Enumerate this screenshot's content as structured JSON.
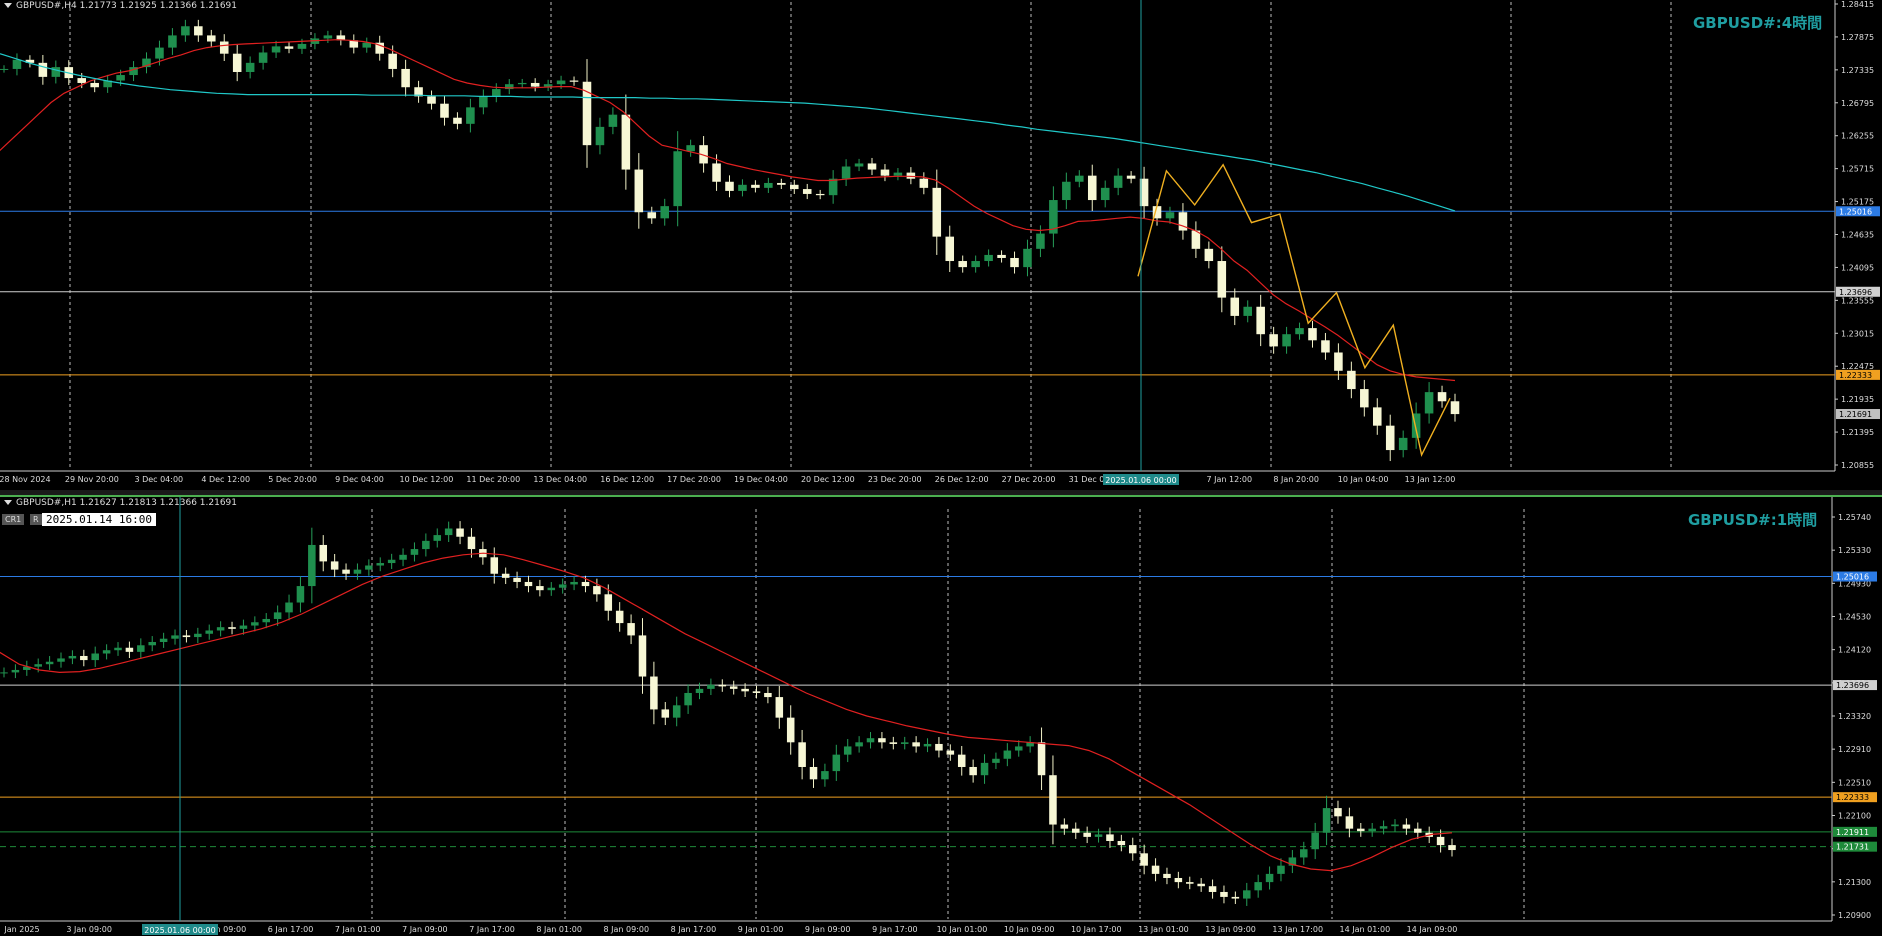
{
  "top_chart": {
    "info": "GBPUSD#,H4  1.21773 1.21925 1.21366 1.21691",
    "watermark": "GBPUSD#:4時間",
    "price_min": 1.20855,
    "price_max": 1.28415,
    "price_labels": [
      "1.28415",
      "1.27875",
      "1.27335",
      "1.26795",
      "1.26255",
      "1.25715",
      "1.25175",
      "1.24635",
      "1.24095",
      "1.23555",
      "1.23015",
      "1.22475",
      "1.21935",
      "1.21395",
      "1.20855"
    ],
    "hlines": [
      {
        "price": 1.25016,
        "label": "1.25016",
        "color": "#2c7be5",
        "text_color": "#ffffff"
      },
      {
        "price": 1.23696,
        "label": "1.23696",
        "color": "#d0d0d0",
        "text_color": "#000000"
      },
      {
        "price": 1.22333,
        "label": "1.22333",
        "color": "#f0a020",
        "text_color": "#000000"
      },
      {
        "price": 1.21691,
        "label": "1.21691",
        "color": "#c0c0c0",
        "text_color": "#000000",
        "tag_only": true
      }
    ],
    "time_labels": [
      "28 Nov 2024",
      "29 Nov 20:00",
      "3 Dec 04:00",
      "4 Dec 12:00",
      "5 Dec 20:00",
      "9 Dec 04:00",
      "10 Dec 12:00",
      "11 Dec 20:00",
      "13 Dec 04:00",
      "16 Dec 12:00",
      "17 Dec 20:00",
      "19 Dec 04:00",
      "20 Dec 12:00",
      "23 Dec 20:00",
      "26 Dec 12:00",
      "27 Dec 20:00",
      "31 Dec 04:00",
      "2 Ja",
      "7 Jan 12:00",
      "8 Jan 20:00",
      "10 Jan 04:00",
      "13 Jan 12:00"
    ],
    "crosshair_time": "2025.01.06 00:00",
    "crosshair_time_tail": "00",
    "zigzag": [
      1.2395,
      1.2568,
      1.2512,
      1.2578,
      1.2483,
      1.2497,
      1.2318,
      1.2368,
      1.2245,
      1.2315,
      1.2102,
      1.2195
    ],
    "close_series": [
      1.2735,
      1.275,
      1.2745,
      1.2722,
      1.2738,
      1.272,
      1.2712,
      1.2705,
      1.2716,
      1.2725,
      1.2738,
      1.2752,
      1.277,
      1.279,
      1.2805,
      1.279,
      1.278,
      1.276,
      1.273,
      1.2745,
      1.2762,
      1.2772,
      1.2768,
      1.2776,
      1.2785,
      1.279,
      1.2782,
      1.277,
      1.2778,
      1.276,
      1.2735,
      1.2705,
      1.269,
      1.2678,
      1.2655,
      1.2645,
      1.2672,
      1.269,
      1.2702,
      1.271,
      1.2712,
      1.2706,
      1.271,
      1.2716,
      1.2714,
      1.261,
      1.264,
      1.266,
      1.257,
      1.25,
      1.249,
      1.251,
      1.26,
      1.261,
      1.258,
      1.255,
      1.2535,
      1.2545,
      1.254,
      1.2548,
      1.2545,
      1.2538,
      1.253,
      1.2528,
      1.2555,
      1.2575,
      1.258,
      1.257,
      1.256,
      1.2565,
      1.2555,
      1.254,
      1.246,
      1.242,
      1.241,
      1.242,
      1.243,
      1.2425,
      1.241,
      1.244,
      1.2465,
      1.252,
      1.255,
      1.256,
      1.252,
      1.254,
      1.256,
      1.2555,
      1.251,
      1.249,
      1.25,
      1.247,
      1.244,
      1.242,
      1.236,
      1.233,
      1.2345,
      1.23,
      1.228,
      1.23,
      1.231,
      1.229,
      1.227,
      1.224,
      1.221,
      1.218,
      1.215,
      1.211,
      1.213,
      1.217,
      1.2205,
      1.219,
      1.2169
    ],
    "ema_fast": [
      1.26,
      1.262,
      1.264,
      1.266,
      1.268,
      1.2695,
      1.2705,
      1.2715,
      1.2722,
      1.2728,
      1.2732,
      1.2738,
      1.2745,
      1.2752,
      1.2758,
      1.2765,
      1.277,
      1.2773,
      1.2775,
      1.2776,
      1.2777,
      1.2778,
      1.2779,
      1.278,
      1.2781,
      1.2782,
      1.2783,
      1.2782,
      1.278,
      1.2776,
      1.2768,
      1.2758,
      1.2748,
      1.2738,
      1.2728,
      1.2718,
      1.2712,
      1.2708,
      1.2705,
      1.2704,
      1.2704,
      1.2704,
      1.2705,
      1.2706,
      1.2706,
      1.27,
      1.269,
      1.268,
      1.2665,
      1.2645,
      1.2625,
      1.261,
      1.2605,
      1.26,
      1.2595,
      1.2588,
      1.258,
      1.2575,
      1.257,
      1.2566,
      1.2562,
      1.2558,
      1.2555,
      1.2552,
      1.2552,
      1.2554,
      1.2556,
      1.2557,
      1.2558,
      1.2559,
      1.2559,
      1.2558,
      1.2553,
      1.254,
      1.2525,
      1.251,
      1.2498,
      1.2488,
      1.2478,
      1.2472,
      1.247,
      1.2472,
      1.2478,
      1.2485,
      1.2486,
      1.2488,
      1.249,
      1.2492,
      1.249,
      1.2486,
      1.2484,
      1.2478,
      1.247,
      1.2458,
      1.244,
      1.242,
      1.2405,
      1.2385,
      1.2365,
      1.235,
      1.2338,
      1.2325,
      1.2312,
      1.2298,
      1.2282,
      1.2266,
      1.225,
      1.224,
      1.2234,
      1.223,
      1.2228,
      1.2226,
      1.2224
    ],
    "sma_slow": [
      1.276,
      1.2752,
      1.2744,
      1.2737,
      1.2731,
      1.2725,
      1.272,
      1.2715,
      1.2711,
      1.2707,
      1.2704,
      1.2701,
      1.2699,
      1.2697,
      1.2695,
      1.2694,
      1.2693,
      1.2693,
      1.2693,
      1.2693,
      1.2693,
      1.2693,
      1.2693,
      1.2693,
      1.2692,
      1.2692,
      1.2692,
      1.2692,
      1.2691,
      1.2691,
      1.2691,
      1.269,
      1.269,
      1.269,
      1.2689,
      1.2689,
      1.2689,
      1.2689,
      1.2688,
      1.2688,
      1.2688,
      1.2688,
      1.2687,
      1.2687,
      1.2686,
      1.2686,
      1.2685,
      1.2684,
      1.2683,
      1.2682,
      1.2681,
      1.268,
      1.2679,
      1.2677,
      1.2675,
      1.2673,
      1.2671,
      1.2668,
      1.2665,
      1.2662,
      1.2659,
      1.2656,
      1.2653,
      1.265,
      1.2647,
      1.2643,
      1.264,
      1.2636,
      1.2633,
      1.263,
      1.2627,
      1.2624,
      1.2621,
      1.2617,
      1.2613,
      1.2609,
      1.2605,
      1.2601,
      1.2597,
      1.2593,
      1.2589,
      1.2585,
      1.258,
      1.2575,
      1.257,
      1.2565,
      1.2559,
      1.2553,
      1.2547,
      1.254,
      1.2533,
      1.2526,
      1.2518,
      1.251,
      1.2502
    ]
  },
  "bottom_chart": {
    "info": "GBPUSD#,H1  1.21627 1.21813 1.21366 1.21691",
    "watermark": "GBPUSD#:1時間",
    "cr1": "CR1",
    "r": "R",
    "datetime": "2025.01.14 16:00",
    "price_min": 1.209,
    "price_max": 1.2574,
    "price_labels": [
      "1.25740",
      "1.25330",
      "1.24930",
      "1.24530",
      "1.24120",
      "1.23710",
      "1.23320",
      "1.22910",
      "1.22510",
      "1.22100",
      "1.21700",
      "1.21300",
      "1.20900"
    ],
    "hlines": [
      {
        "price": 1.25016,
        "label": "1.25016",
        "color": "#2c7be5",
        "text_color": "#ffffff"
      },
      {
        "price": 1.23696,
        "label": "1.23696",
        "color": "#d0d0d0",
        "text_color": "#000000"
      },
      {
        "price": 1.22333,
        "label": "1.22333",
        "color": "#f0a020",
        "text_color": "#000000"
      },
      {
        "price": 1.21911,
        "label": "1.21911",
        "color": "#1e8a3a",
        "text_color": "#ffffff"
      },
      {
        "price": 1.21731,
        "label": "1.21731",
        "color": "#1e8a3a",
        "text_color": "#ffffff",
        "dashed": true
      }
    ],
    "time_labels": [
      "Jan 2025",
      "3 Jan 09:00",
      "3 Ja",
      "6 Jan 09:00",
      "6 Jan 17:00",
      "7 Jan 01:00",
      "7 Jan 09:00",
      "7 Jan 17:00",
      "8 Jan 01:00",
      "8 Jan 09:00",
      "8 Jan 17:00",
      "9 Jan 01:00",
      "9 Jan 09:00",
      "9 Jan 17:00",
      "10 Jan 01:00",
      "10 Jan 09:00",
      "10 Jan 17:00",
      "13 Jan 01:00",
      "13 Jan 09:00",
      "13 Jan 17:00",
      "14 Jan 01:00",
      "14 Jan 09:00"
    ],
    "crosshair_time": "2025.01.06 00:00",
    "close_series": [
      1.2385,
      1.2388,
      1.2392,
      1.2395,
      1.2398,
      1.2402,
      1.2405,
      1.24,
      1.2408,
      1.2412,
      1.2415,
      1.241,
      1.2418,
      1.2422,
      1.2426,
      1.243,
      1.2428,
      1.2432,
      1.2436,
      1.244,
      1.2438,
      1.2442,
      1.2446,
      1.245,
      1.2458,
      1.247,
      1.249,
      1.254,
      1.252,
      1.251,
      1.2505,
      1.251,
      1.2515,
      1.2518,
      1.2522,
      1.2528,
      1.2535,
      1.2545,
      1.2552,
      1.256,
      1.255,
      1.2535,
      1.2525,
      1.2505,
      1.25,
      1.2495,
      1.249,
      1.2485,
      1.2488,
      1.2492,
      1.2495,
      1.249,
      1.248,
      1.246,
      1.2445,
      1.243,
      1.238,
      1.234,
      1.233,
      1.2345,
      1.236,
      1.2365,
      1.237,
      1.2368,
      1.2365,
      1.2362,
      1.236,
      1.2355,
      1.233,
      1.23,
      1.227,
      1.2255,
      1.2265,
      1.2285,
      1.2295,
      1.23,
      1.2305,
      1.23,
      1.2298,
      1.23,
      1.2295,
      1.2298,
      1.229,
      1.2285,
      1.227,
      1.226,
      1.2275,
      1.228,
      1.229,
      1.2295,
      1.23,
      1.226,
      1.22,
      1.2195,
      1.219,
      1.2185,
      1.2188,
      1.218,
      1.2175,
      1.2165,
      1.215,
      1.214,
      1.2135,
      1.213,
      1.2128,
      1.2125,
      1.2118,
      1.2112,
      1.211,
      1.212,
      1.213,
      1.214,
      1.215,
      1.216,
      1.217,
      1.219,
      1.222,
      1.221,
      1.2195,
      1.2192,
      1.2195,
      1.2198,
      1.22,
      1.2195,
      1.219,
      1.2185,
      1.2175,
      1.2169
    ],
    "ema": [
      1.241,
      1.2395,
      1.2388,
      1.2385,
      1.2386,
      1.239,
      1.2396,
      1.2402,
      1.2408,
      1.2414,
      1.242,
      1.2426,
      1.2432,
      1.2438,
      1.2446,
      1.2456,
      1.2468,
      1.248,
      1.2492,
      1.2502,
      1.251,
      1.2518,
      1.2524,
      1.2528,
      1.253,
      1.2528,
      1.2522,
      1.2515,
      1.2508,
      1.25,
      1.2488,
      1.2474,
      1.246,
      1.2446,
      1.2432,
      1.242,
      1.2408,
      1.2396,
      1.2384,
      1.2372,
      1.236,
      1.235,
      1.234,
      1.2332,
      1.2326,
      1.232,
      1.2315,
      1.231,
      1.2306,
      1.2304,
      1.2302,
      1.23,
      1.2298,
      1.2296,
      1.229,
      1.228,
      1.2266,
      1.2252,
      1.2238,
      1.2224,
      1.2208,
      1.2192,
      1.2176,
      1.2162,
      1.2152,
      1.2146,
      1.2144,
      1.215,
      1.216,
      1.2172,
      1.2182,
      1.2188,
      1.219
    ]
  }
}
